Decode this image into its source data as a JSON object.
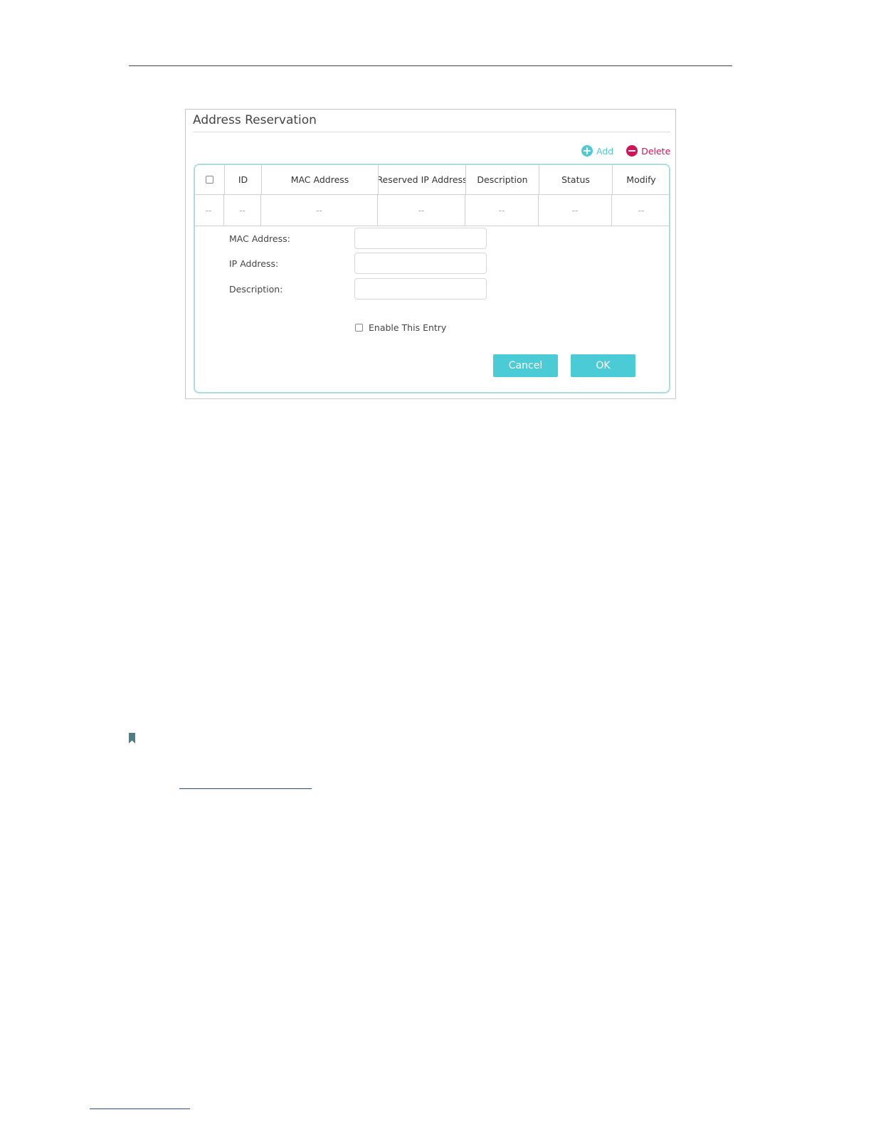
{
  "panel": {
    "title": "Address Reservation"
  },
  "actions": {
    "add_label": "Add",
    "delete_label": "Delete"
  },
  "table": {
    "columns": [
      "",
      "ID",
      "MAC Address",
      "Reserved IP Address",
      "Description",
      "Status",
      "Modify"
    ],
    "row": [
      "--",
      "--",
      "--",
      "--",
      "--",
      "--",
      "--"
    ]
  },
  "form": {
    "mac_label": "MAC Address:",
    "ip_label": "IP Address:",
    "description_label": "Description:",
    "mac_value": "",
    "ip_value": "",
    "description_value": "",
    "enable_label": "Enable This Entry",
    "enable_checked": false,
    "cancel_label": "Cancel",
    "ok_label": "OK"
  },
  "colors": {
    "accent": "#4acbd6",
    "delete": "#d0145a",
    "table_border": "#a8dde2"
  }
}
